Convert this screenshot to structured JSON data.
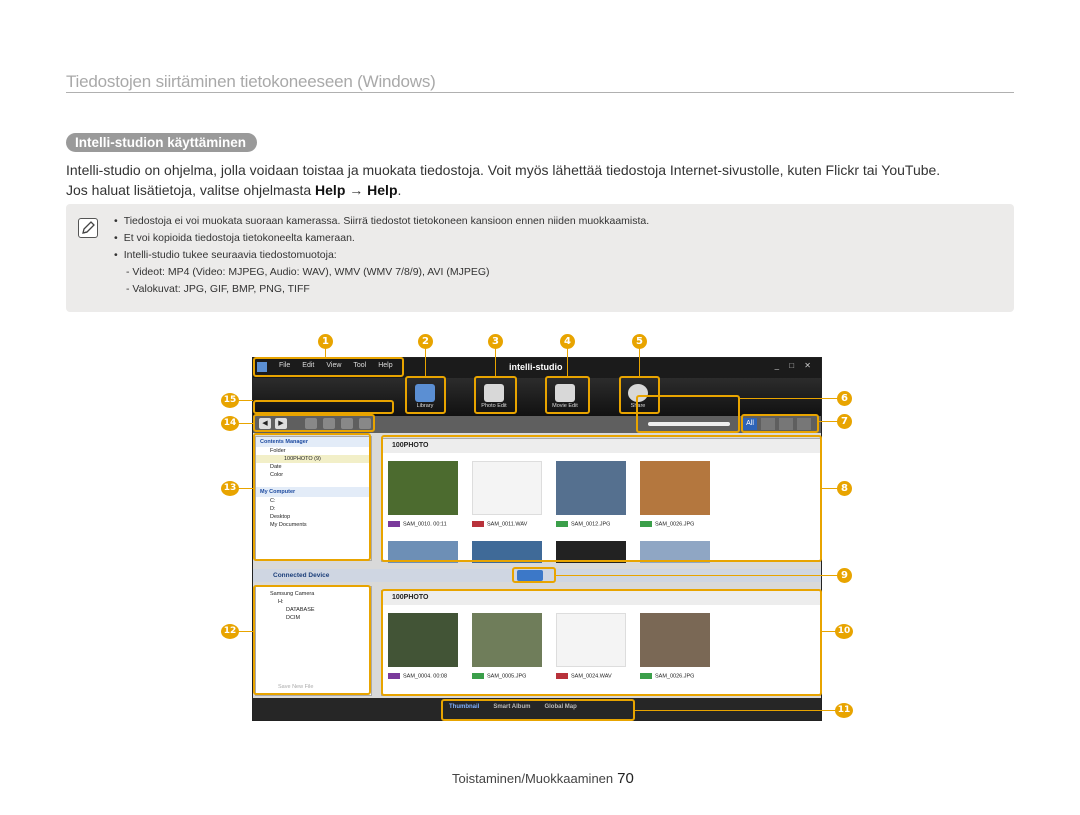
{
  "header": {
    "title": "Tiedostojen siirtäminen tietokoneeseen (Windows)"
  },
  "section": {
    "title": "Intelli-studion käyttäminen"
  },
  "intro": {
    "line1": "Intelli-studio on ohjelma, jolla voidaan toistaa ja muokata tiedostoja. Voit myös lähettää tiedostoja Internet-sivustolle, kuten Flickr tai YouTube.",
    "line2_prefix": "Jos haluat lisätietoja, valitse ohjelmasta ",
    "help1": "Help",
    "arrow": " → ",
    "help2": "Help",
    "line2_suffix": "."
  },
  "note": {
    "icon": "note-pencil-icon",
    "bullets": [
      "Tiedostoja ei voi muokata suoraan kamerassa. Siirrä tiedostot tietokoneen kansioon ennen niiden muokkaamista.",
      "Et voi kopioida tiedostoja tietokoneelta kameraan.",
      "Intelli-studio tukee seuraavia tiedostomuotoja:"
    ],
    "sub": [
      "Videot: MP4 (Video: MJPEG, Audio: WAV), WMV (WMV 7/8/9), AVI (MJPEG)",
      "Valokuvat: JPG, GIF, BMP, PNG, TIFF"
    ]
  },
  "callouts": [
    "1",
    "2",
    "3",
    "4",
    "5",
    "6",
    "7",
    "8",
    "9",
    "10",
    "11",
    "12",
    "13",
    "14",
    "15"
  ],
  "app": {
    "menu": [
      "File",
      "Edit",
      "View",
      "Tool",
      "Help"
    ],
    "brand": "intelli-studio",
    "window_controls": "_ □ ✕",
    "tools": [
      "Library",
      "Photo Edit",
      "Movie Edit",
      "Share"
    ],
    "view_all": "All",
    "tree_top": {
      "header": "Contents Manager",
      "rows": [
        "Folder",
        "100PHOTO",
        "Date",
        "Color"
      ],
      "count": "(9)",
      "header2": "My Computer",
      "rows2": [
        "C:",
        "D:",
        "Desktop",
        "My Documents"
      ]
    },
    "folder_label": "100PHOTO",
    "top_files": [
      "SAM_0010.  00:11",
      "SAM_0011.WAV",
      "SAM_0012.JPG",
      "SAM_0026.JPG"
    ],
    "connected": "Connected Device",
    "tree_bottom": {
      "rows": [
        "Samsung Camera",
        "H:",
        "DATABASE",
        "DCIM"
      ],
      "save": "Save New File"
    },
    "bottom_files": [
      "SAM_0004.  00:08",
      "SAM_0005.JPG",
      "SAM_0024.WAV",
      "SAM_0026.JPG"
    ],
    "tabs": [
      "Thumbnail",
      "Smart Album",
      "Global Map"
    ]
  },
  "footer": {
    "section": "Toistaminen/Muokkaaminen",
    "page": "70"
  }
}
